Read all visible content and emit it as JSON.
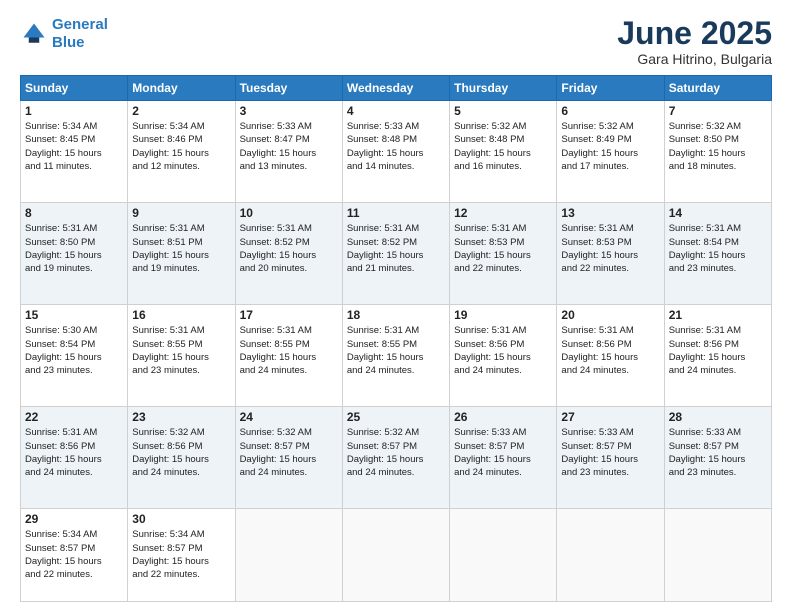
{
  "header": {
    "logo_line1": "General",
    "logo_line2": "Blue",
    "month": "June 2025",
    "location": "Gara Hitrino, Bulgaria"
  },
  "days_of_week": [
    "Sunday",
    "Monday",
    "Tuesday",
    "Wednesday",
    "Thursday",
    "Friday",
    "Saturday"
  ],
  "weeks": [
    [
      {
        "day": "1",
        "info": "Sunrise: 5:34 AM\nSunset: 8:45 PM\nDaylight: 15 hours\nand 11 minutes."
      },
      {
        "day": "2",
        "info": "Sunrise: 5:34 AM\nSunset: 8:46 PM\nDaylight: 15 hours\nand 12 minutes."
      },
      {
        "day": "3",
        "info": "Sunrise: 5:33 AM\nSunset: 8:47 PM\nDaylight: 15 hours\nand 13 minutes."
      },
      {
        "day": "4",
        "info": "Sunrise: 5:33 AM\nSunset: 8:48 PM\nDaylight: 15 hours\nand 14 minutes."
      },
      {
        "day": "5",
        "info": "Sunrise: 5:32 AM\nSunset: 8:48 PM\nDaylight: 15 hours\nand 16 minutes."
      },
      {
        "day": "6",
        "info": "Sunrise: 5:32 AM\nSunset: 8:49 PM\nDaylight: 15 hours\nand 17 minutes."
      },
      {
        "day": "7",
        "info": "Sunrise: 5:32 AM\nSunset: 8:50 PM\nDaylight: 15 hours\nand 18 minutes."
      }
    ],
    [
      {
        "day": "8",
        "info": "Sunrise: 5:31 AM\nSunset: 8:50 PM\nDaylight: 15 hours\nand 19 minutes."
      },
      {
        "day": "9",
        "info": "Sunrise: 5:31 AM\nSunset: 8:51 PM\nDaylight: 15 hours\nand 19 minutes."
      },
      {
        "day": "10",
        "info": "Sunrise: 5:31 AM\nSunset: 8:52 PM\nDaylight: 15 hours\nand 20 minutes."
      },
      {
        "day": "11",
        "info": "Sunrise: 5:31 AM\nSunset: 8:52 PM\nDaylight: 15 hours\nand 21 minutes."
      },
      {
        "day": "12",
        "info": "Sunrise: 5:31 AM\nSunset: 8:53 PM\nDaylight: 15 hours\nand 22 minutes."
      },
      {
        "day": "13",
        "info": "Sunrise: 5:31 AM\nSunset: 8:53 PM\nDaylight: 15 hours\nand 22 minutes."
      },
      {
        "day": "14",
        "info": "Sunrise: 5:31 AM\nSunset: 8:54 PM\nDaylight: 15 hours\nand 23 minutes."
      }
    ],
    [
      {
        "day": "15",
        "info": "Sunrise: 5:30 AM\nSunset: 8:54 PM\nDaylight: 15 hours\nand 23 minutes."
      },
      {
        "day": "16",
        "info": "Sunrise: 5:31 AM\nSunset: 8:55 PM\nDaylight: 15 hours\nand 23 minutes."
      },
      {
        "day": "17",
        "info": "Sunrise: 5:31 AM\nSunset: 8:55 PM\nDaylight: 15 hours\nand 24 minutes."
      },
      {
        "day": "18",
        "info": "Sunrise: 5:31 AM\nSunset: 8:55 PM\nDaylight: 15 hours\nand 24 minutes."
      },
      {
        "day": "19",
        "info": "Sunrise: 5:31 AM\nSunset: 8:56 PM\nDaylight: 15 hours\nand 24 minutes."
      },
      {
        "day": "20",
        "info": "Sunrise: 5:31 AM\nSunset: 8:56 PM\nDaylight: 15 hours\nand 24 minutes."
      },
      {
        "day": "21",
        "info": "Sunrise: 5:31 AM\nSunset: 8:56 PM\nDaylight: 15 hours\nand 24 minutes."
      }
    ],
    [
      {
        "day": "22",
        "info": "Sunrise: 5:31 AM\nSunset: 8:56 PM\nDaylight: 15 hours\nand 24 minutes."
      },
      {
        "day": "23",
        "info": "Sunrise: 5:32 AM\nSunset: 8:56 PM\nDaylight: 15 hours\nand 24 minutes."
      },
      {
        "day": "24",
        "info": "Sunrise: 5:32 AM\nSunset: 8:57 PM\nDaylight: 15 hours\nand 24 minutes."
      },
      {
        "day": "25",
        "info": "Sunrise: 5:32 AM\nSunset: 8:57 PM\nDaylight: 15 hours\nand 24 minutes."
      },
      {
        "day": "26",
        "info": "Sunrise: 5:33 AM\nSunset: 8:57 PM\nDaylight: 15 hours\nand 24 minutes."
      },
      {
        "day": "27",
        "info": "Sunrise: 5:33 AM\nSunset: 8:57 PM\nDaylight: 15 hours\nand 23 minutes."
      },
      {
        "day": "28",
        "info": "Sunrise: 5:33 AM\nSunset: 8:57 PM\nDaylight: 15 hours\nand 23 minutes."
      }
    ],
    [
      {
        "day": "29",
        "info": "Sunrise: 5:34 AM\nSunset: 8:57 PM\nDaylight: 15 hours\nand 22 minutes."
      },
      {
        "day": "30",
        "info": "Sunrise: 5:34 AM\nSunset: 8:57 PM\nDaylight: 15 hours\nand 22 minutes."
      },
      null,
      null,
      null,
      null,
      null
    ]
  ]
}
